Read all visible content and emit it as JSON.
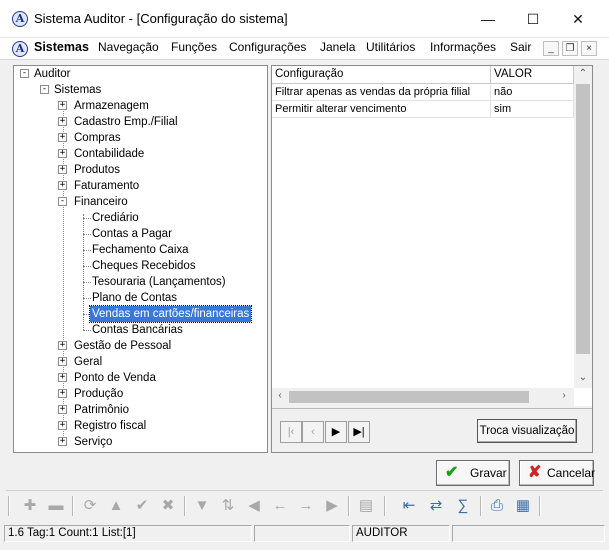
{
  "window": {
    "title": "Sistema Auditor - [Configuração do sistema]",
    "icon": "app-logo-icon",
    "controls": [
      "minimize-icon",
      "maximize-icon",
      "close-icon"
    ]
  },
  "menu": {
    "items": [
      "Sistemas",
      "Navegação",
      "Funções",
      "Configurações",
      "Janela",
      "Utilitários",
      "Informações",
      "Sair"
    ]
  },
  "tree": {
    "root": "Auditor",
    "child": "Sistemas",
    "groups_before": [
      "Armazenagem",
      "Cadastro Emp./Filial",
      "Compras",
      "Contabilidade",
      "Produtos",
      "Faturamento"
    ],
    "expanded_group": "Financeiro",
    "financeiro_children": [
      "Crediário",
      "Contas a Pagar",
      "Fechamento Caixa",
      "Cheques Recebidos",
      "Tesouraria (Lançamentos)",
      "Plano de Contas",
      "Vendas em cartões/financeiras",
      "Contas Bancárias"
    ],
    "selected": "Vendas em cartões/financeiras",
    "groups_after": [
      "Gestão de Pessoal",
      "Geral",
      "Ponto de Venda",
      "Produção",
      "Patrimônio",
      "Registro fiscal",
      "Serviço"
    ]
  },
  "grid": {
    "headers": [
      "Configuração",
      "VALOR"
    ],
    "rows": [
      [
        "Filtrar apenas as vendas da própria filial",
        "não"
      ],
      [
        "Permitir alterar vencimento",
        "sim"
      ]
    ]
  },
  "navigator": {
    "buttons": [
      "first-icon",
      "prior-icon",
      "next-icon",
      "last-icon"
    ],
    "troca_label": "Troca visualização"
  },
  "actions": {
    "gravar": "Gravar",
    "cancelar": "Cancelar"
  },
  "status": {
    "info": "1.6 Tag:1 Count:1 List:[1]",
    "user": "AUDITOR"
  },
  "colors": {
    "selection": "#3a78d8",
    "gravar_icon": "#18a018",
    "cancelar_icon": "#d42020"
  }
}
